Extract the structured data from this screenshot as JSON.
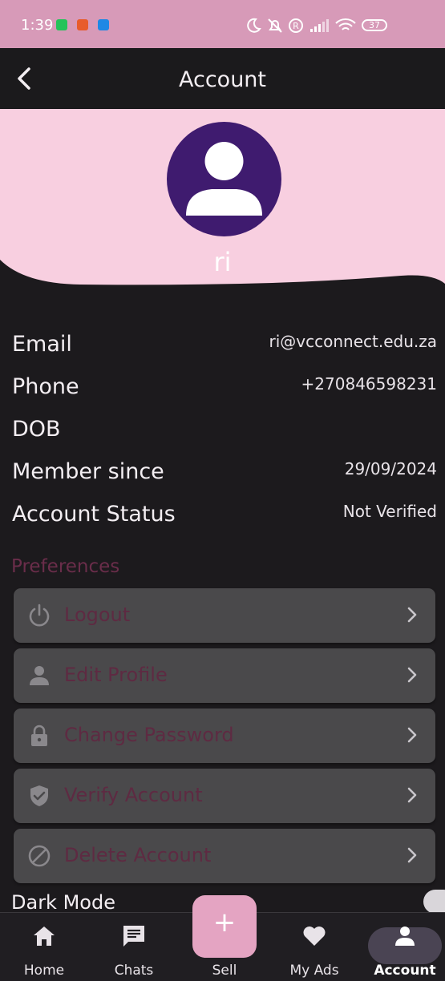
{
  "status_bar": {
    "time": "1:39",
    "battery": "37",
    "bg_color": "#d79ab8"
  },
  "app_bar": {
    "title": "Account",
    "back_icon": "chevron-left-icon"
  },
  "profile": {
    "name": "ri",
    "avatar_icon": "person-icon",
    "avatar_color": "#3f1b6f",
    "header_color": "#f8cfe0"
  },
  "info": [
    {
      "label": "Email",
      "value": "ri@vcconnect.edu.za"
    },
    {
      "label": "Phone",
      "value": "+270846598231"
    },
    {
      "label": "DOB",
      "value": ""
    },
    {
      "label": "Member since",
      "value": "29/09/2024"
    },
    {
      "label": "Account Status",
      "value": "Not Verified"
    }
  ],
  "preferences": {
    "title": "Preferences",
    "items": [
      {
        "label": "Logout",
        "icon": "power-icon"
      },
      {
        "label": "Edit Profile",
        "icon": "person-icon"
      },
      {
        "label": "Change Password",
        "icon": "lock-icon"
      },
      {
        "label": "Verify Account",
        "icon": "shield-check-icon"
      },
      {
        "label": "Delete Account",
        "icon": "block-icon"
      }
    ]
  },
  "dark_mode": {
    "label": "Dark Mode"
  },
  "bottom_nav": {
    "items": [
      {
        "label": "Home",
        "icon": "home-icon"
      },
      {
        "label": "Chats",
        "icon": "chat-icon"
      },
      {
        "label": "Sell",
        "icon": "plus-icon"
      },
      {
        "label": "My Ads",
        "icon": "heart-icon"
      },
      {
        "label": "Account",
        "icon": "person-icon"
      }
    ],
    "active": "Account",
    "accent_color": "#e4a4c2"
  }
}
